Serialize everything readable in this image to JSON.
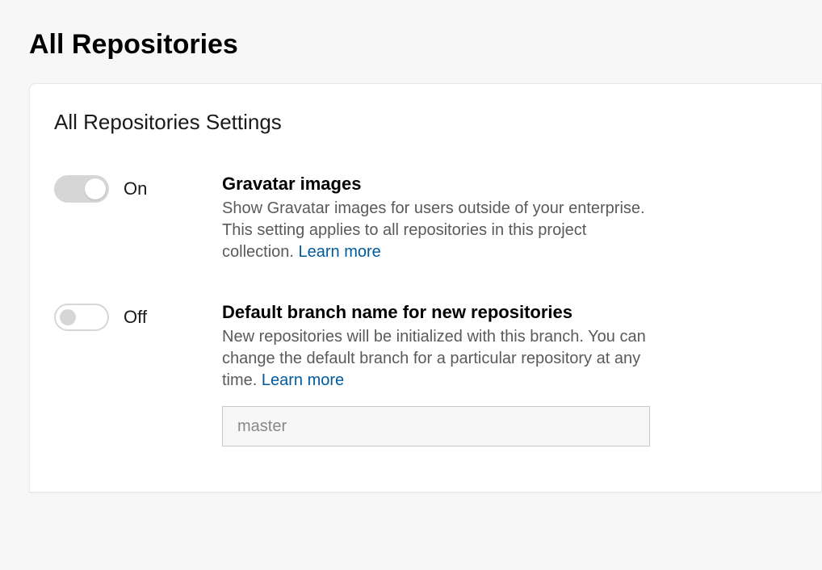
{
  "header": {
    "title": "All Repositories"
  },
  "card": {
    "title": "All Repositories Settings"
  },
  "settings": {
    "gravatar": {
      "state_label": "On",
      "title": "Gravatar images",
      "description": "Show Gravatar images for users outside of your enterprise. This setting applies to all repositories in this project collection. ",
      "learn_more": "Learn more"
    },
    "defaultBranch": {
      "state_label": "Off",
      "title": "Default branch name for new repositories",
      "description": "New repositories will be initialized with this branch. You can change the default branch for a particular repository at any time. ",
      "learn_more": "Learn more",
      "placeholder": "master",
      "value": ""
    }
  }
}
